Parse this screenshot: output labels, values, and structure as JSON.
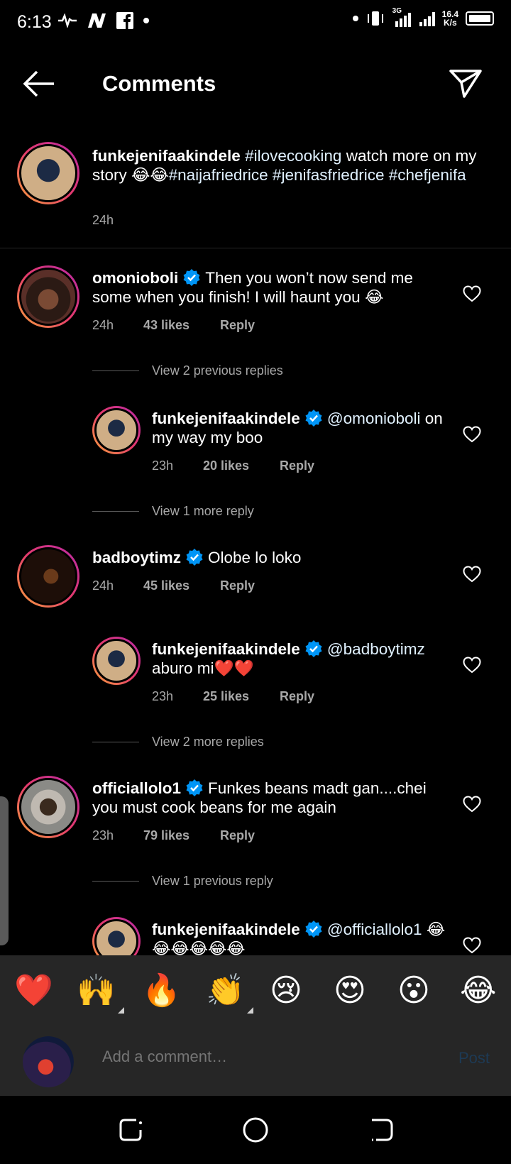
{
  "status_bar": {
    "time": "6:13",
    "speed_value": "16.4",
    "speed_unit": "K/s",
    "network": "3G"
  },
  "header": {
    "title": "Comments"
  },
  "caption": {
    "username": "funkejenifaakindele",
    "hashtag1": "#ilovecooking",
    "text1": " watch more on my story ",
    "emoji": "😂😂",
    "hashtags2": "#naijafriedrice #jenifasfriedrice #chefjenifa",
    "time": "24h"
  },
  "comments": [
    {
      "username": "omonioboli",
      "text": "Then you won’t now send me some when you finish! I will haunt you 😂",
      "time": "24h",
      "likes": "43 likes",
      "reply": "Reply"
    },
    {
      "username": "funkejenifaakindele",
      "mention": "@omonioboli",
      "text": "on my way my boo",
      "time": "23h",
      "likes": "20 likes",
      "reply": "Reply"
    },
    {
      "username": "badboytimz",
      "text": "Olobe lo loko",
      "time": "24h",
      "likes": "45 likes",
      "reply": "Reply"
    },
    {
      "username": "funkejenifaakindele",
      "mention": "@badboytimz",
      "text": "aburo mi❤️❤️",
      "time": "23h",
      "likes": "25 likes",
      "reply": "Reply"
    },
    {
      "username": "officiallolo1",
      "text": "Funkes beans madt gan....chei you must cook beans for me again",
      "time": "23h",
      "likes": "79 likes",
      "reply": "Reply"
    },
    {
      "username": "funkejenifaakindele",
      "mention": "@officiallolo1",
      "text": "😂😂😂😂😂😂"
    }
  ],
  "view_replies": [
    "View 2 previous replies",
    "View 1 more reply",
    "View 2 more replies",
    "View 1 previous reply"
  ],
  "emoji_bar": [
    "❤️",
    "🙌",
    "🔥",
    "👏",
    "😢",
    "😍",
    "😮",
    "😂"
  ],
  "composer": {
    "placeholder": "Add a comment…",
    "post_label": "Post"
  },
  "colors": {
    "background": "#000000",
    "panel": "#262626",
    "verified": "#0095f6",
    "muted": "#a8a8a8",
    "post_disabled": "#1d3a55"
  }
}
